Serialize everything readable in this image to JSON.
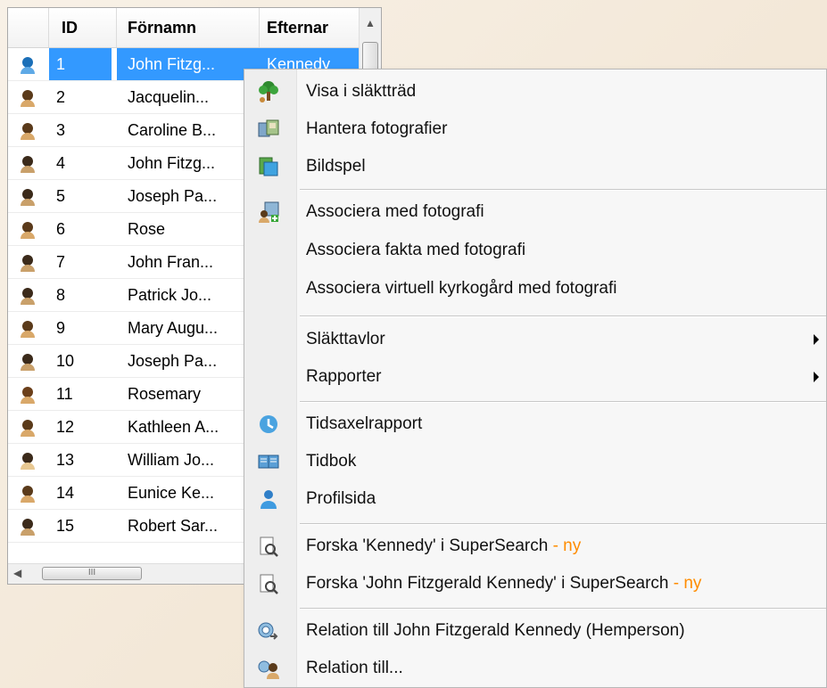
{
  "grid": {
    "columns": [
      "ID",
      "Förnamn",
      "Efternar"
    ],
    "rows": [
      {
        "id": "1",
        "first": "John Fitzg...",
        "last": "Kennedy",
        "selected": true
      },
      {
        "id": "2",
        "first": "Jacquelin...",
        "last": ""
      },
      {
        "id": "3",
        "first": "Caroline B...",
        "last": ""
      },
      {
        "id": "4",
        "first": "John Fitzg...",
        "last": ""
      },
      {
        "id": "5",
        "first": "Joseph Pa...",
        "last": ""
      },
      {
        "id": "6",
        "first": "Rose",
        "last": ""
      },
      {
        "id": "7",
        "first": "John Fran...",
        "last": ""
      },
      {
        "id": "8",
        "first": "Patrick Jo...",
        "last": ""
      },
      {
        "id": "9",
        "first": "Mary Augu...",
        "last": ""
      },
      {
        "id": "10",
        "first": "Joseph Pa...",
        "last": ""
      },
      {
        "id": "11",
        "first": "Rosemary",
        "last": ""
      },
      {
        "id": "12",
        "first": "Kathleen A...",
        "last": ""
      },
      {
        "id": "13",
        "first": "William Jo...",
        "last": ""
      },
      {
        "id": "14",
        "first": "Eunice Ke...",
        "last": ""
      },
      {
        "id": "15",
        "first": "Robert Sar...",
        "last": ""
      }
    ],
    "hscroll_grip": "III"
  },
  "menu": {
    "items": [
      {
        "label": "Visa i släktträd",
        "icon": "family-tree-icon"
      },
      {
        "label": "Hantera fotografier",
        "icon": "photos-icon"
      },
      {
        "label": "Bildspel",
        "icon": "slideshow-icon"
      },
      {
        "label": "Associera med fotografi",
        "icon": "associate-photo-icon"
      },
      {
        "label": "Associera fakta med fotografi",
        "icon": ""
      },
      {
        "label": "Associera virtuell kyrkogård med fotografi",
        "icon": ""
      },
      {
        "label": "Släkttavlor",
        "icon": "",
        "submenu": true
      },
      {
        "label": "Rapporter",
        "icon": "",
        "submenu": true
      },
      {
        "label": "Tidsaxelrapport",
        "icon": "timeline-icon"
      },
      {
        "label": "Tidbok",
        "icon": "book-icon"
      },
      {
        "label": "Profilsida",
        "icon": "person-icon"
      },
      {
        "label": "Forska 'Kennedy' i SuperSearch",
        "suffix": " - ny",
        "icon": "search-doc-icon"
      },
      {
        "label": "Forska 'John Fitzgerald Kennedy' i SuperSearch",
        "suffix": " - ny",
        "icon": "search-doc-icon"
      },
      {
        "label": "Relation till John Fitzgerald Kennedy (Hemperson)",
        "icon": "relation-icon"
      },
      {
        "label": "Relation till...",
        "icon": "relation-people-icon"
      }
    ]
  },
  "colors": {
    "selection": "#3399ff",
    "new_badge": "#ff8c00"
  }
}
